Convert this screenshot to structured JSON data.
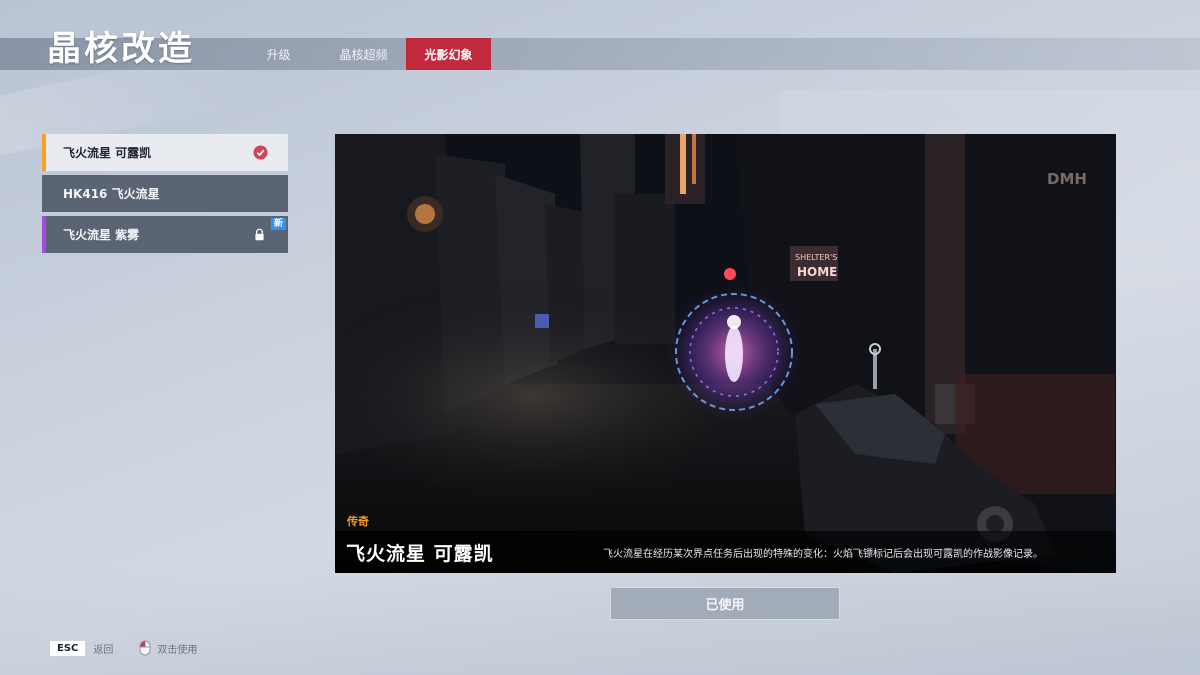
{
  "header": {
    "title": "晶核改造",
    "tabs": [
      {
        "label": "升级"
      },
      {
        "label": "晶核超频"
      },
      {
        "label": "光影幻象"
      }
    ],
    "active_tab_color": "#c2293d"
  },
  "variants": [
    {
      "label": "飞火流星 可露凯",
      "state": "equipped",
      "accent": "#f2a224"
    },
    {
      "label": "HK416 飞火流星",
      "state": "normal"
    },
    {
      "label": "飞火流星 紫雾",
      "state": "locked",
      "badge": "新",
      "accent": "#a64be0"
    }
  ],
  "preview": {
    "rarity": "传奇",
    "rarity_color": "#f39a22",
    "name": "飞火流星 可露凯",
    "description": "飞火流星在经历某次界点任务后出现的特殊的变化：火焰飞镖标记后会出现可露凯的作战影像记录。",
    "scene_signs": [
      "SHELTER'S HOME",
      "DMH"
    ]
  },
  "action_button": {
    "label": "已使用"
  },
  "footer": {
    "esc_key": "ESC",
    "back_label": "返回",
    "double_click_label": "双击使用"
  }
}
